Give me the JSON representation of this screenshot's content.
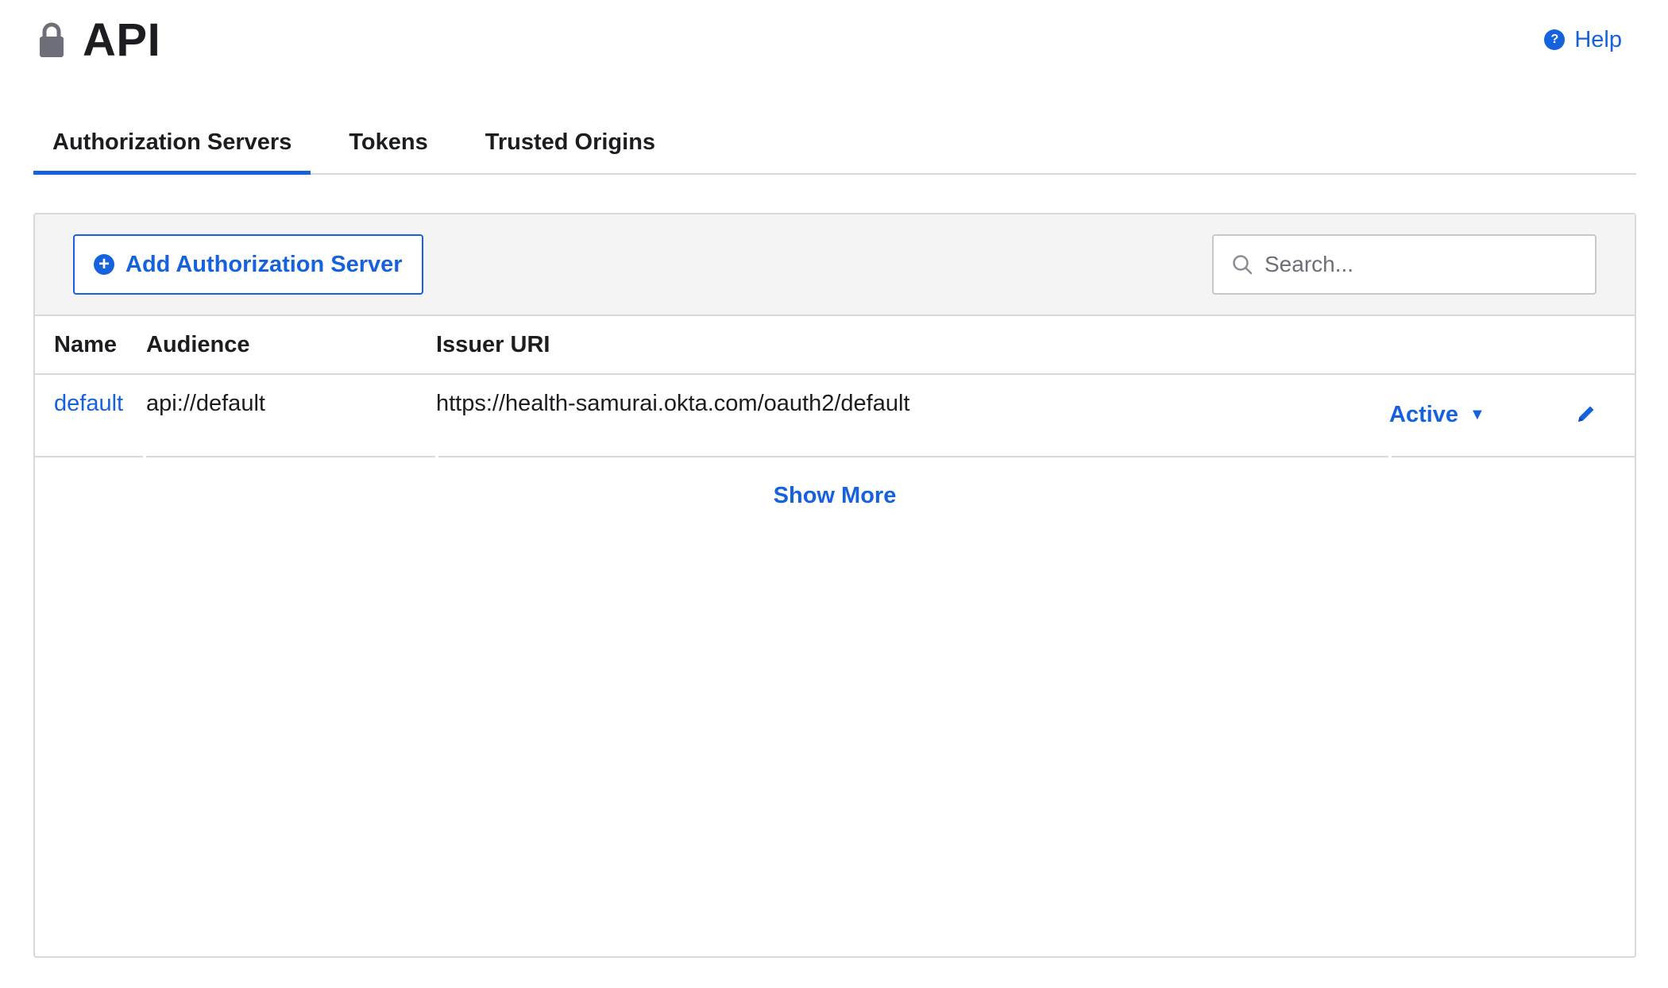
{
  "header": {
    "title": "API",
    "help_label": "Help"
  },
  "tabs": [
    {
      "label": "Authorization Servers",
      "active": true
    },
    {
      "label": "Tokens",
      "active": false
    },
    {
      "label": "Trusted Origins",
      "active": false
    }
  ],
  "toolbar": {
    "add_label": "Add Authorization Server",
    "search_placeholder": "Search..."
  },
  "table": {
    "columns": [
      "Name",
      "Audience",
      "Issuer URI"
    ],
    "rows": [
      {
        "name": "default",
        "audience": "api://default",
        "issuer_uri": "https://health-samurai.okta.com/oauth2/default",
        "status": "Active"
      }
    ]
  },
  "show_more_label": "Show More",
  "colors": {
    "accent": "#1662dd",
    "text": "#1d1d21",
    "border": "#d7d7dc",
    "toolbar_bg": "#f4f4f4"
  },
  "icons": {
    "title": "lock-icon",
    "help": "help-circle-icon",
    "add": "plus-circle-icon",
    "search": "search-icon",
    "status": "caret-down-icon",
    "edit": "pencil-icon"
  }
}
